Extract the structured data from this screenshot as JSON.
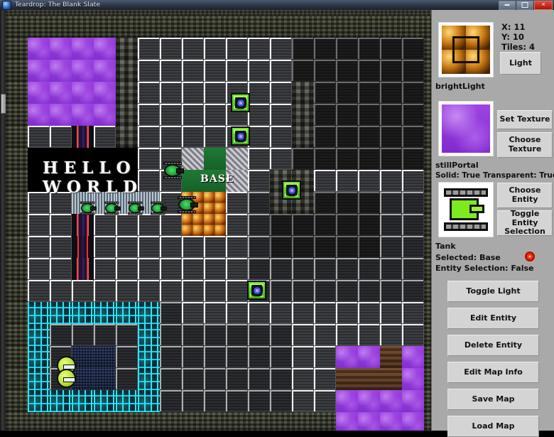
{
  "window": {
    "title": "Teardrop: The Blank Slate",
    "icon": "app-icon",
    "buttons": {
      "minimize": "minimize",
      "maximize": "maximize",
      "close": "close"
    }
  },
  "panel": {
    "cursor": {
      "x_label": "X: 11",
      "y_label": "Y: 10",
      "tiles_label": "Tiles: 4"
    },
    "light": {
      "button": "Light",
      "name": "brightLight",
      "thumbnail": "bright-light-texture"
    },
    "texture": {
      "set_button": "Set Texture",
      "choose_button": "Choose Texture",
      "name": "stillPortal",
      "solid": "Solid: True",
      "transparent": "Transparent: True",
      "thumbnail": "still-portal-texture"
    },
    "entity": {
      "choose_button": "Choose Entity",
      "toggle_button": "Toggle Entity Selection",
      "name": "Tank",
      "selected": "Selected: Base",
      "selection": "Entity Selection: False",
      "thumbnail": "tank-sprite",
      "indicator": "red-dot"
    },
    "actions": [
      {
        "label": "Toggle Light",
        "name": "toggle-light"
      },
      {
        "label": "Edit Entity",
        "name": "edit-entity"
      },
      {
        "label": "Delete Entity",
        "name": "delete-entity"
      },
      {
        "label": "Edit Map Info",
        "name": "edit-map-info"
      },
      {
        "label": "Save Map",
        "name": "save-map"
      },
      {
        "label": "Load Map",
        "name": "load-map"
      }
    ]
  },
  "map": {
    "hello_line1": "HELLO",
    "hello_line2": "WORLD",
    "base_label": "BASE"
  },
  "colors": {
    "portal": "#9b3fe0",
    "lava": "#c86a10",
    "circuit": "#28e8f5",
    "entity_green": "#77e637",
    "panel_bg": "#a9a9a9",
    "button_bg": "#d4d4d4",
    "indicator_red": "#ff2a00"
  }
}
